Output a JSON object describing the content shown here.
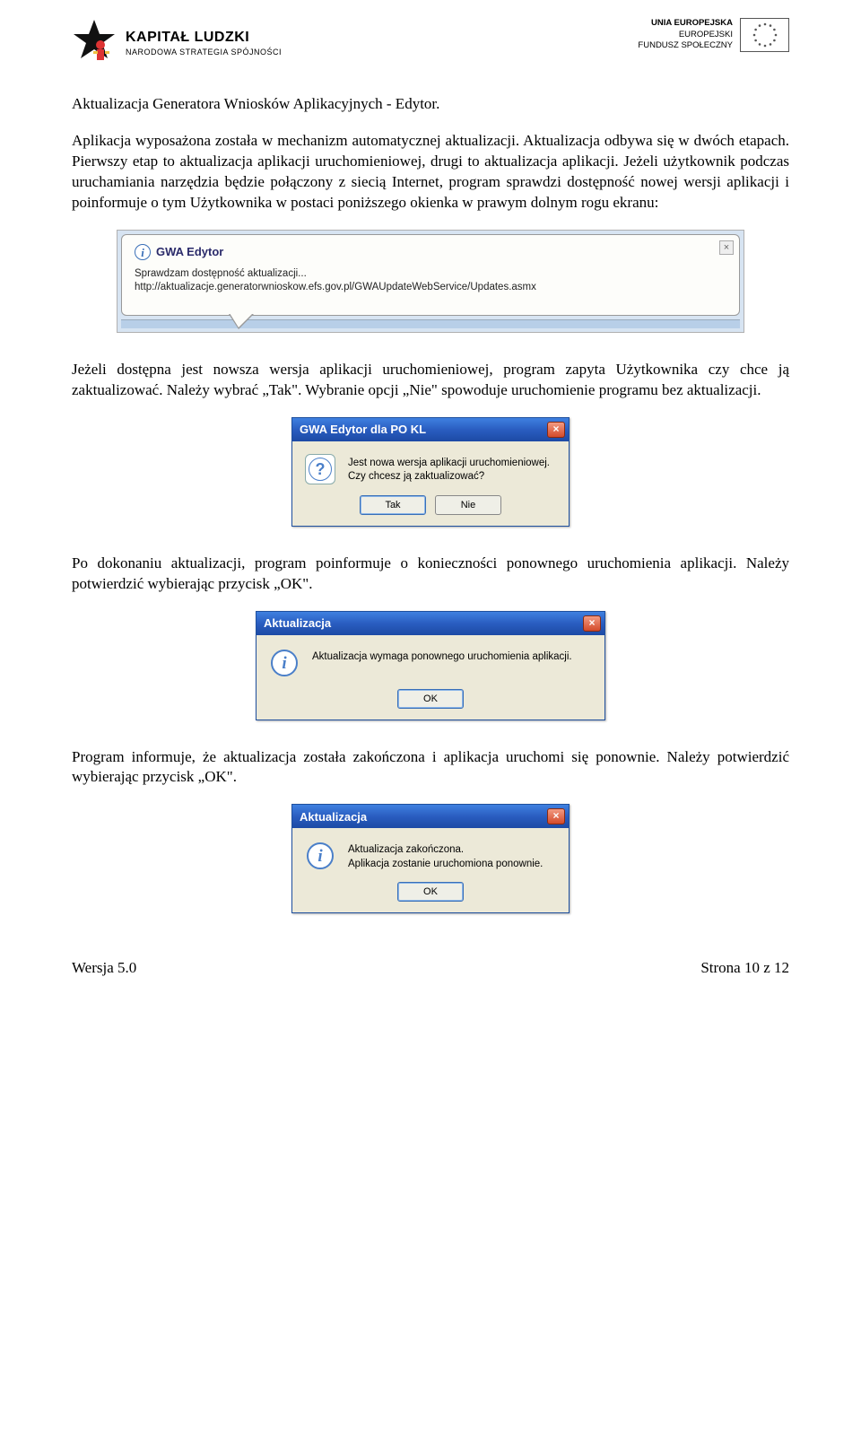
{
  "header": {
    "left_title": "KAPITAŁ LUDZKI",
    "left_sub": "NARODOWA STRATEGIA SPÓJNOŚCI",
    "right_line1": "UNIA EUROPEJSKA",
    "right_line2": "EUROPEJSKI",
    "right_line3": "FUNDUSZ SPOŁECZNY"
  },
  "title": "Aktualizacja Generatora Wniosków Aplikacyjnych - Edytor.",
  "para1": "Aplikacja wyposażona została w mechanizm automatycznej aktualizacji. Aktualizacja odbywa się w dwóch etapach. Pierwszy etap to aktualizacja aplikacji uruchomieniowej, drugi to aktualizacja aplikacji. Jeżeli użytkownik podczas uruchamiania narzędzia będzie połączony z siecią Internet, program sprawdzi dostępność nowej wersji aplikacji i poinformuje o tym Użytkownika w postaci poniższego okienka w prawym dolnym rogu ekranu:",
  "notification": {
    "title": "GWA Edytor",
    "body": "Sprawdzam dostępność aktualizacji...\nhttp://aktualizacje.generatorwnioskow.efs.gov.pl/GWAUpdateWebService/Updates.asmx",
    "close": "×"
  },
  "para2": "Jeżeli dostępna jest nowsza wersja aplikacji uruchomieniowej, program zapyta Użytkownika czy chce ją zaktualizować. Należy wybrać „Tak\". Wybranie opcji „Nie\" spowoduje uruchomienie programu bez aktualizacji.",
  "dialog1": {
    "title": "GWA Edytor dla PO KL",
    "text": "Jest nowa wersja aplikacji uruchomieniowej.\nCzy chcesz ją zaktualizować?",
    "btn_yes": "Tak",
    "btn_no": "Nie",
    "close": "×"
  },
  "para3": "Po dokonaniu aktualizacji, program poinformuje o konieczności ponownego uruchomienia aplikacji. Należy potwierdzić wybierając przycisk „OK\".",
  "dialog2": {
    "title": "Aktualizacja",
    "text": "Aktualizacja wymaga ponownego uruchomienia aplikacji.",
    "btn_ok": "OK",
    "close": "×"
  },
  "para4": "Program informuje, że aktualizacja została zakończona i aplikacja uruchomi się ponownie. Należy potwierdzić wybierając przycisk „OK\".",
  "dialog3": {
    "title": "Aktualizacja",
    "text": "Aktualizacja zakończona.\nAplikacja zostanie uruchomiona ponownie.",
    "btn_ok": "OK",
    "close": "×"
  },
  "footer": {
    "left": "Wersja 5.0",
    "right": "Strona 10 z 12"
  }
}
